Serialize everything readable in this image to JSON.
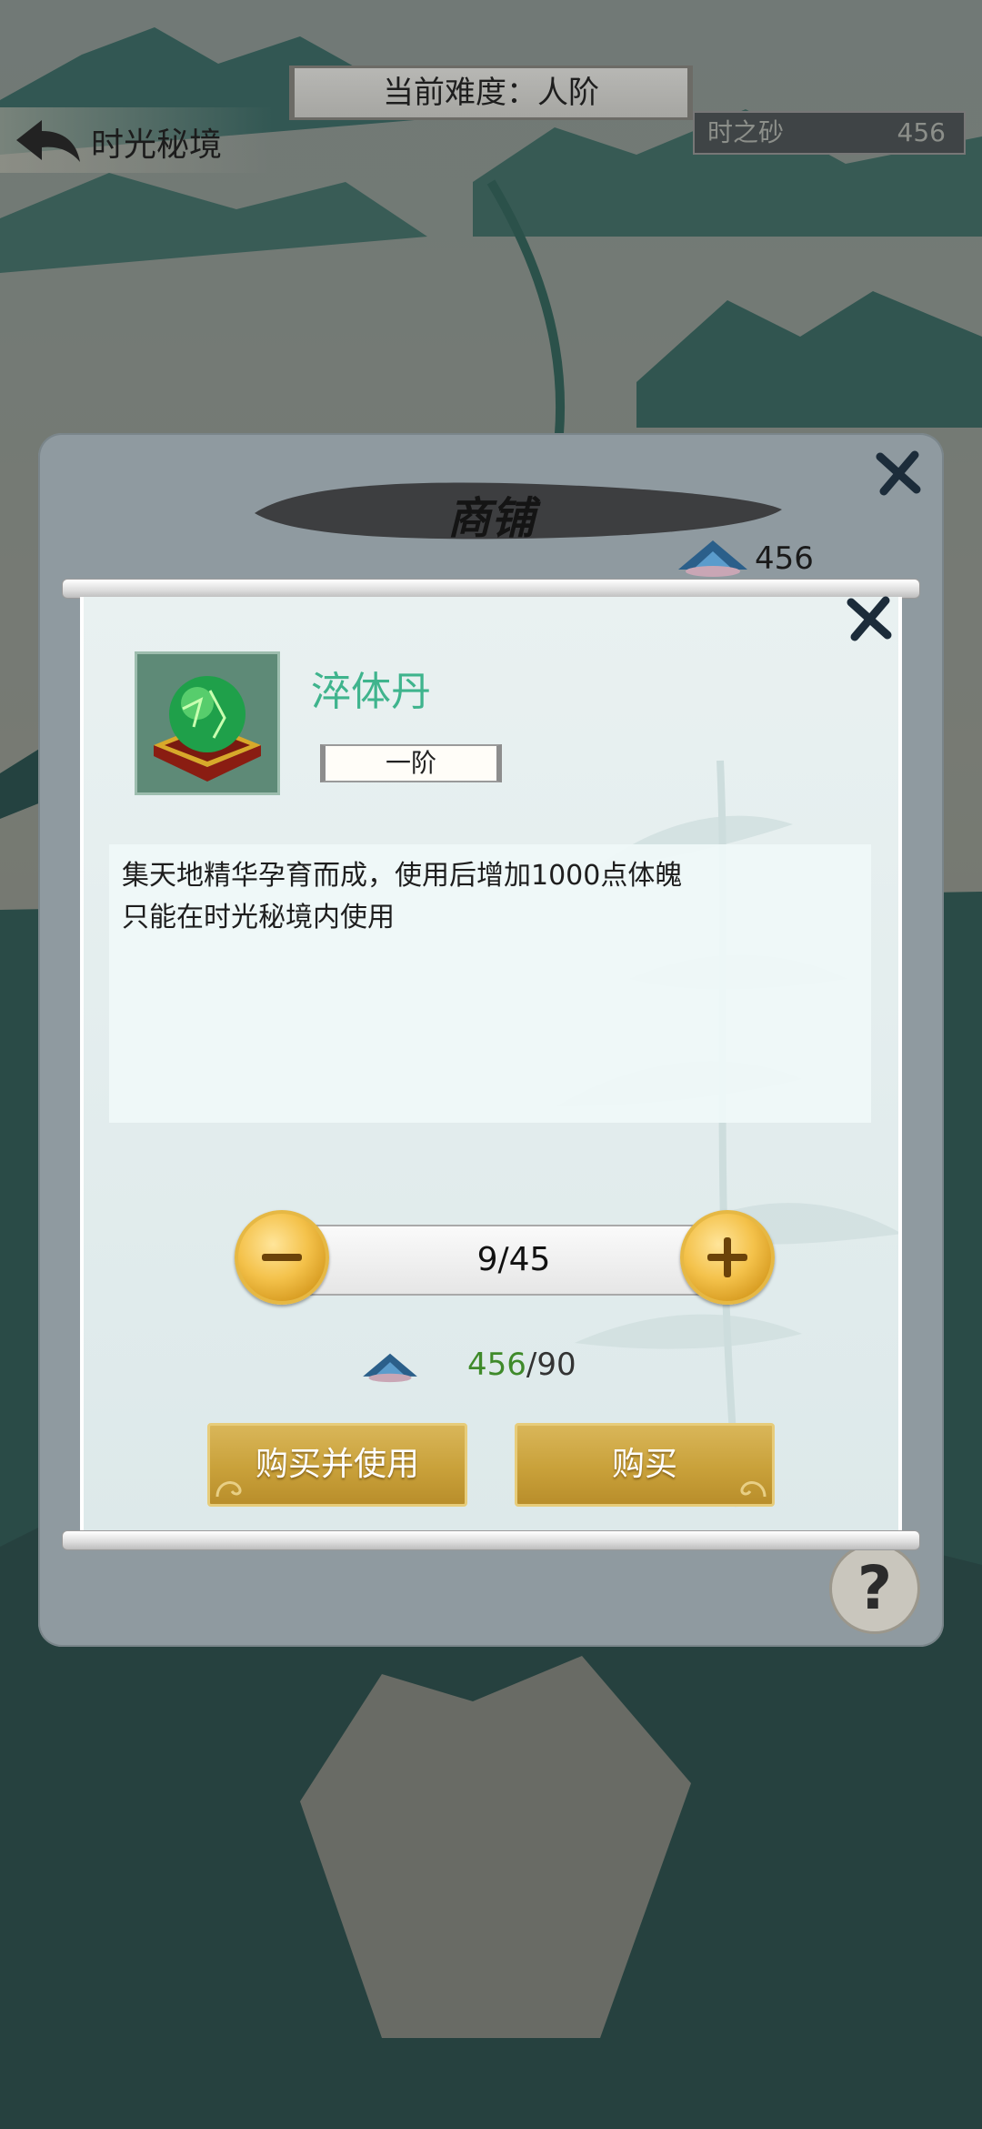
{
  "header": {
    "difficulty_label": "当前难度：人阶",
    "back_title": "时光秘境",
    "currency_name": "时之砂",
    "currency_value": "456"
  },
  "shop": {
    "title": "商铺",
    "currency_value": "456"
  },
  "item": {
    "name": "淬体丹",
    "tier": "一阶",
    "description": [
      "集天地精华孕育而成，使用后增加1000点体魄",
      "只能在时光秘境内使用"
    ]
  },
  "quantity": {
    "display": "9/45"
  },
  "price": {
    "have": "456",
    "need": "/90"
  },
  "buttons": {
    "buy_and_use": "购买并使用",
    "buy": "购买",
    "help": "?"
  },
  "colors": {
    "item_name": "#3fb48d",
    "gold_button": "#c9a13a",
    "have_amount": "#3f8a2a"
  }
}
